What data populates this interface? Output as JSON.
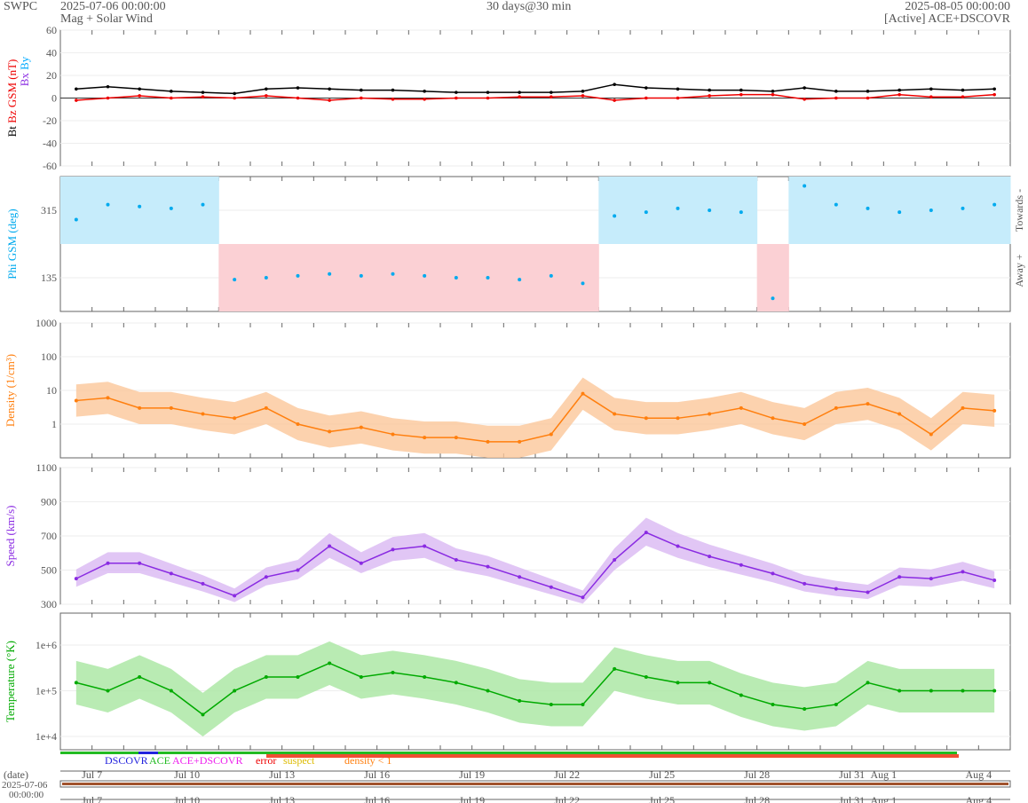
{
  "header": {
    "org": "SWPC",
    "start": "2025-07-06 00:00:00",
    "subtitle": "Mag + Solar Wind",
    "span": "30 days@30 min",
    "end": "2025-08-05 00:00:00",
    "source": "[Active] ACE+DSCOVR"
  },
  "colors": {
    "bt": "#000000",
    "bz": "#ee0000",
    "bx": "#8a2be2",
    "by": "#00aaff",
    "phi": "#00aaee",
    "phi_towards": "#c6ecfb",
    "phi_away": "#fbd0d4",
    "density": "#ff7f0e",
    "density_band": "#fbc79a",
    "speed": "#8a2be2",
    "speed_band": "#d9b8f3",
    "temp": "#00aa00",
    "temp_band": "#a8e6a0"
  },
  "chart_data": [
    {
      "type": "line",
      "name": "mag",
      "ylabel_bt": "Bt",
      "ylabel_bz": "Bz GSM (nT)",
      "ylabel_bx": "Bx",
      "ylabel_by": "By",
      "ylim": [
        -60,
        60
      ],
      "yticks": [
        "60",
        "40",
        "20",
        "0",
        "-20",
        "-40",
        "-60"
      ],
      "ytick_values": [
        60,
        40,
        20,
        0,
        -20,
        -40,
        -60
      ],
      "days": [
        0,
        1,
        2,
        3,
        4,
        5,
        6,
        7,
        8,
        9,
        10,
        11,
        12,
        13,
        14,
        15,
        16,
        17,
        18,
        19,
        20,
        21,
        22,
        23,
        24,
        25,
        26,
        27,
        28,
        29
      ],
      "series": [
        {
          "name": "Bt",
          "values": [
            8,
            10,
            8,
            6,
            5,
            4,
            8,
            9,
            8,
            7,
            7,
            6,
            5,
            5,
            5,
            5,
            6,
            12,
            9,
            8,
            7,
            7,
            6,
            9,
            6,
            6,
            7,
            8,
            7,
            8
          ]
        },
        {
          "name": "Bz",
          "values": [
            -2,
            0,
            2,
            0,
            1,
            0,
            2,
            0,
            -2,
            0,
            -1,
            -1,
            0,
            0,
            1,
            1,
            2,
            -2,
            0,
            0,
            2,
            3,
            3,
            -1,
            0,
            0,
            3,
            1,
            1,
            3
          ]
        }
      ]
    },
    {
      "type": "scatter",
      "name": "phi",
      "ylabel": "Phi GSM (deg)",
      "ylim": [
        45,
        405
      ],
      "yticks": [
        "315",
        "135"
      ],
      "ytick_values": [
        315,
        135
      ],
      "right_labels": [
        "Towards -",
        "Away +"
      ],
      "days": [
        0,
        1,
        2,
        3,
        4,
        5,
        6,
        7,
        8,
        9,
        10,
        11,
        12,
        13,
        14,
        15,
        16,
        17,
        18,
        19,
        20,
        21,
        22,
        23,
        24,
        25,
        26,
        27,
        28,
        29
      ],
      "values": [
        290,
        330,
        325,
        320,
        330,
        130,
        135,
        140,
        145,
        140,
        145,
        140,
        135,
        135,
        130,
        140,
        120,
        300,
        310,
        320,
        315,
        310,
        80,
        380,
        330,
        320,
        310,
        315,
        320,
        330
      ]
    },
    {
      "type": "line",
      "name": "density",
      "ylabel": "Density (1/cm³)",
      "scale": "log",
      "ylim": [
        0.1,
        1000
      ],
      "yticks": [
        "1000",
        "100",
        "10",
        "1"
      ],
      "ytick_values": [
        1000,
        100,
        10,
        1
      ],
      "days": [
        0,
        1,
        2,
        3,
        4,
        5,
        6,
        7,
        8,
        9,
        10,
        11,
        12,
        13,
        14,
        15,
        16,
        17,
        18,
        19,
        20,
        21,
        22,
        23,
        24,
        25,
        26,
        27,
        28,
        29
      ],
      "values": [
        5,
        6,
        3,
        3,
        2,
        1.5,
        3,
        1,
        0.6,
        0.8,
        0.5,
        0.4,
        0.4,
        0.3,
        0.3,
        0.5,
        8,
        2,
        1.5,
        1.5,
        2,
        3,
        1.5,
        1,
        3,
        4,
        2,
        0.5,
        3,
        2.5
      ]
    },
    {
      "type": "line",
      "name": "speed",
      "ylabel": "Speed (km/s)",
      "ylim": [
        300,
        1100
      ],
      "yticks": [
        "1100",
        "900",
        "700",
        "500",
        "300"
      ],
      "ytick_values": [
        1100,
        900,
        700,
        500,
        300
      ],
      "days": [
        0,
        1,
        2,
        3,
        4,
        5,
        6,
        7,
        8,
        9,
        10,
        11,
        12,
        13,
        14,
        15,
        16,
        17,
        18,
        19,
        20,
        21,
        22,
        23,
        24,
        25,
        26,
        27,
        28,
        29
      ],
      "values": [
        450,
        540,
        540,
        480,
        420,
        350,
        460,
        500,
        640,
        540,
        620,
        640,
        560,
        520,
        460,
        400,
        340,
        560,
        720,
        640,
        580,
        530,
        480,
        420,
        390,
        370,
        460,
        450,
        490,
        440
      ]
    },
    {
      "type": "line",
      "name": "temperature",
      "ylabel": "Temperature (°K)",
      "scale": "log",
      "ylim": [
        5100,
        5000000
      ],
      "yticks": [
        "1e+6",
        "1e+5",
        "1e+4"
      ],
      "ytick_values": [
        1000000,
        100000,
        10000
      ],
      "days": [
        0,
        1,
        2,
        3,
        4,
        5,
        6,
        7,
        8,
        9,
        10,
        11,
        12,
        13,
        14,
        15,
        16,
        17,
        18,
        19,
        20,
        21,
        22,
        23,
        24,
        25,
        26,
        27,
        28,
        29
      ],
      "values": [
        150000,
        100000,
        200000,
        100000,
        30000,
        100000,
        200000,
        200000,
        400000,
        200000,
        250000,
        200000,
        150000,
        100000,
        60000,
        50000,
        50000,
        300000,
        200000,
        150000,
        150000,
        80000,
        50000,
        40000,
        50000,
        150000,
        100000,
        100000,
        100000,
        100000
      ]
    }
  ],
  "xaxis": {
    "labels": [
      "Jul 7",
      "Jul 10",
      "Jul 13",
      "Jul 16",
      "Jul 19",
      "Jul 22",
      "Jul 25",
      "Jul 28",
      "Jul 31",
      "Aug 1",
      "Aug 4"
    ],
    "label_days": [
      1,
      4,
      7,
      10,
      13,
      16,
      19,
      22,
      25,
      26,
      29
    ],
    "total_days": 30
  },
  "legend": {
    "dscovr": "DSCOVR",
    "ace": "ACE",
    "both": "ACE+DSCOVR",
    "error": "error",
    "suspect": "suspect",
    "density": "density < 1"
  },
  "slider": {
    "label": "(date)",
    "date": "2025-07-06",
    "time": "00:00:00"
  }
}
